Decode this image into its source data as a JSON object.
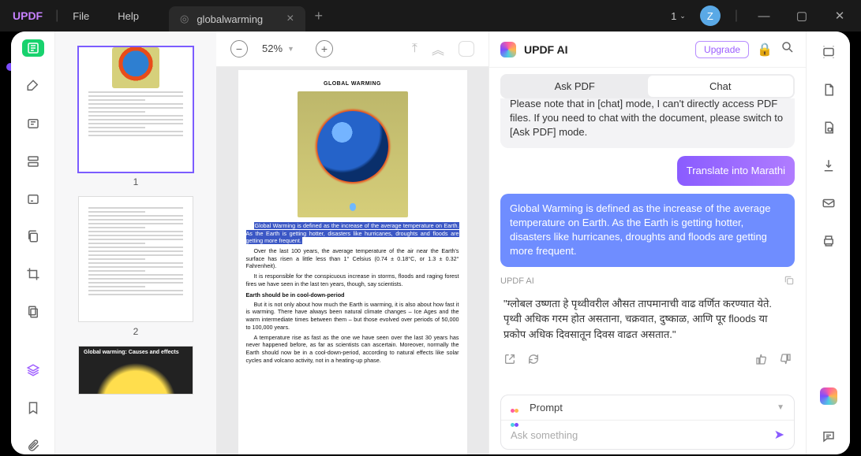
{
  "titlebar": {
    "logo": "UPDF",
    "menu": {
      "file": "File",
      "help": "Help"
    },
    "tab_name": "globalwarming",
    "doc_count": "1",
    "avatar_letter": "Z"
  },
  "thumbs": {
    "page1": "1",
    "page2": "2",
    "page3_caption": "Global warming: Causes and effects"
  },
  "doc": {
    "zoom": "52%",
    "title": "GLOBAL WARMING",
    "hl": "Global Warming is defined as the increase of the average temperature on Earth. As the Earth is getting hotter, disasters like hurricanes, droughts and floods are getting more frequent.",
    "p1": "Over the last 100 years, the average temperature of the air near the Earth's surface has risen a little less than 1° Celsius (0.74 ± 0.18°C, or 1.3 ± 0.32° Fahrenheit).",
    "p2": "It is responsible for the conspicuous increase in storms, floods and raging forest fires we have seen in the last ten years, though, say scientists.",
    "h1": "Earth should be in cool-down-period",
    "p3": "But it is not only about how much the Earth is warming, it is also about how fast it is warming. There have always been natural climate changes – Ice Ages and the warm intermediate times between them – but those evolved over periods of 50,000 to 100,000 years.",
    "p4": "A temperature rise as fast as the one we have seen over the last 30 years has never happened before, as far as scientists can ascertain. Moreover, normally the Earth should now be in a cool-down-period, according to natural effects like solar cycles and volcano activity, not in a heating-up phase."
  },
  "ai": {
    "title": "UPDF AI",
    "upgrade": "Upgrade",
    "tab_ask": "Ask PDF",
    "tab_chat": "Chat",
    "sys_msg": "Please note that in [chat] mode, I can't directly access PDF files. If you need to chat with the document, please switch to [Ask PDF] mode.",
    "user_msg1": "Translate into Marathi",
    "user_msg2": "Global Warming is defined as the increase of the average temperature on Earth. As the Earth is getting hotter, disasters like hurricanes, droughts and floods are getting more frequent.",
    "label": "UPDF AI",
    "response": "\"ग्लोबल उष्णता हे पृथ्वीवरील औसत तापमानाची वाढ वर्णित करण्यात येते. पृथ्वी अधिक गरम होत असताना, चक्रवात, दुष्काळ, आणि पूर floods या प्रकोप अधिक दिवसातून दिवस वाढत असतात.\"",
    "prompt_label": "Prompt",
    "input_placeholder": "Ask something"
  }
}
